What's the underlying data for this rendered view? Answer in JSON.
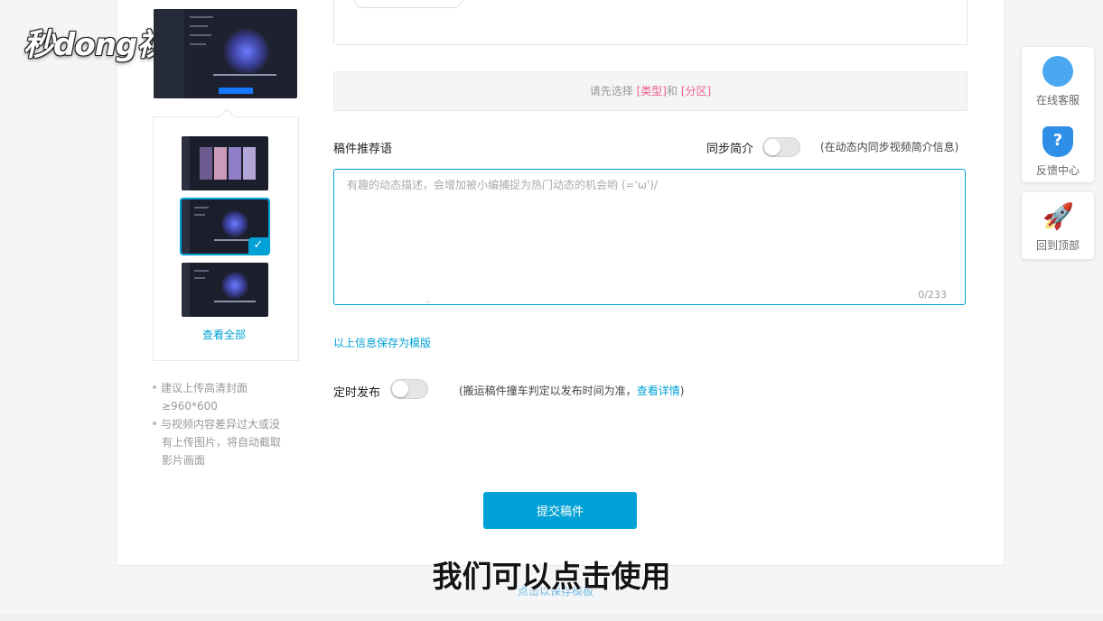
{
  "watermark": {
    "logo_text": "秒dong视频"
  },
  "cover": {
    "view_all": "查看全部",
    "tips": [
      "建议上传高清封面",
      "≥960*600",
      "与视频内容差异过大或没",
      "有上传图片，将自动截取",
      "影片画面"
    ]
  },
  "category_bar": {
    "prefix": "请先选择 ",
    "type": "[类型]",
    "and": "和 ",
    "zone": "[分区]"
  },
  "recommend": {
    "label": "稿件推荐语",
    "sync_label": "同步简介",
    "sync_note": "(在动态内同步视频简介信息)",
    "sync_on": false,
    "placeholder": "有趣的动态描述，会增加被小编捕捉为热门动态的机会哟 (='ω')/",
    "counter": "0/233"
  },
  "save_template": "以上信息保存为模版",
  "schedule": {
    "label": "定时发布",
    "enabled": false,
    "note_before": "(搬运稿件撞车判定以发布时间为准，",
    "note_link": "查看详情",
    "note_after": ")"
  },
  "submit_label": "提交稿件",
  "hidden_link": "点击以保存模板",
  "subtitle": "我们可以点击使用",
  "side_widgets": [
    {
      "label": "在线客服",
      "icon": "chat-bubble-icon"
    },
    {
      "label": "反馈中心",
      "icon": "question-shield-icon"
    },
    {
      "label": "回到顶部",
      "icon": "rocket-icon"
    }
  ],
  "colors": {
    "accent": "#00a1d6",
    "highlight": "#f25d8e"
  }
}
